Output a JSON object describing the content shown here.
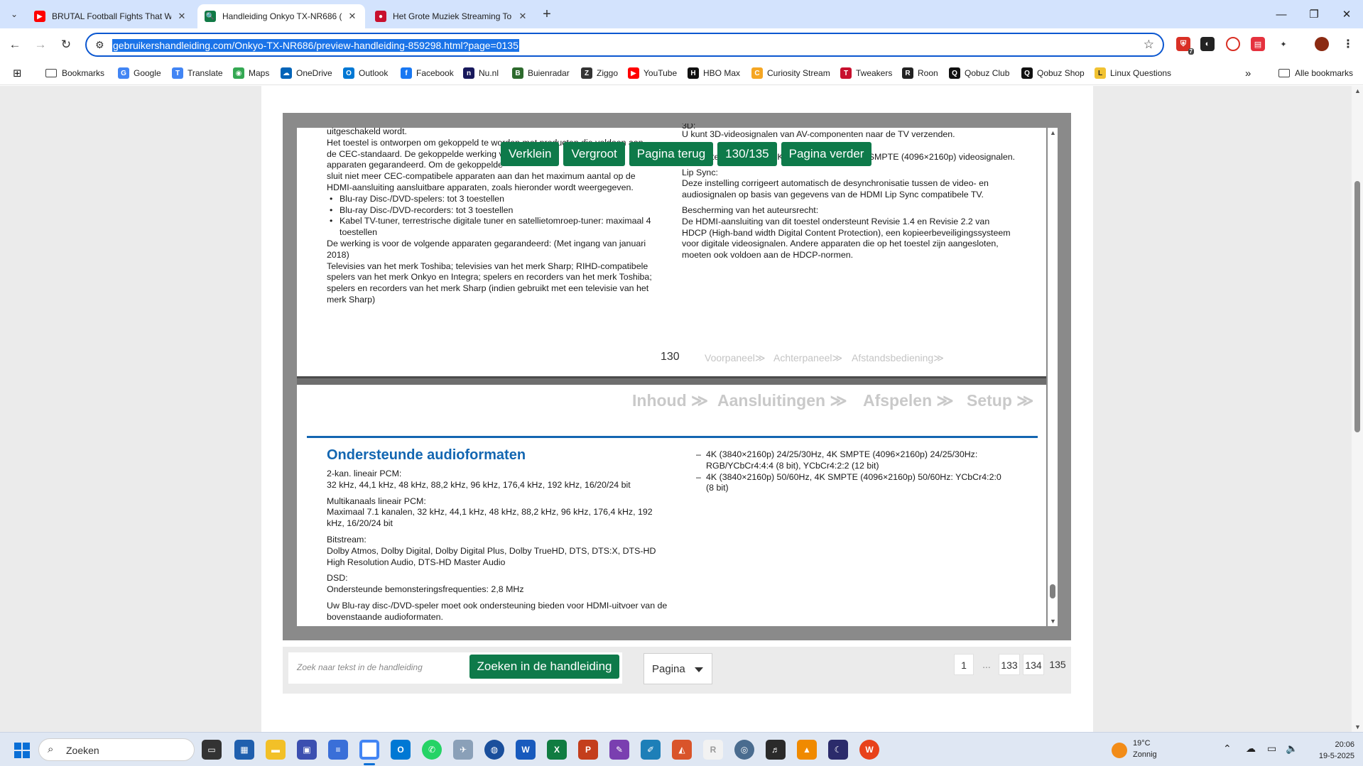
{
  "browser": {
    "tabs": [
      {
        "title": "BRUTAL Football Fights That W",
        "favicon": "youtube-icon",
        "color": "#ff0000"
      },
      {
        "title": "Handleiding Onkyo TX-NR686 (",
        "favicon": "manual-icon",
        "color": "#117a46"
      },
      {
        "title": "Het Grote Muziek Streaming To",
        "favicon": "streaming-icon",
        "color": "#c8102e"
      }
    ],
    "url": "gebruikershandleiding.com/Onkyo-TX-NR686/preview-handleiding-859298.html?page=0135",
    "extension_badge": "7",
    "bookmarks": [
      {
        "label": "Bookmarks",
        "icon": "folder-icon"
      },
      {
        "label": "Google",
        "icon": "google-icon",
        "color": "#4285f4",
        "glyph": "G"
      },
      {
        "label": "Translate",
        "icon": "translate-icon",
        "color": "#4285f4",
        "glyph": "T"
      },
      {
        "label": "Maps",
        "icon": "maps-icon",
        "color": "#34a853",
        "glyph": "◉"
      },
      {
        "label": "OneDrive",
        "icon": "onedrive-icon",
        "color": "#0364b8",
        "glyph": "☁"
      },
      {
        "label": "Outlook",
        "icon": "outlook-icon",
        "color": "#0078d4",
        "glyph": "O"
      },
      {
        "label": "Facebook",
        "icon": "facebook-icon",
        "color": "#1877f2",
        "glyph": "f"
      },
      {
        "label": "Nu.nl",
        "icon": "nunl-icon",
        "color": "#18195c",
        "glyph": "n"
      },
      {
        "label": "Buienradar",
        "icon": "buienradar-icon",
        "color": "#2d6a2d",
        "glyph": "B"
      },
      {
        "label": "Ziggo",
        "icon": "ziggo-icon",
        "color": "#333333",
        "glyph": "Z"
      },
      {
        "label": "YouTube",
        "icon": "youtube-icon",
        "color": "#ff0000",
        "glyph": "▶"
      },
      {
        "label": "HBO Max",
        "icon": "hbomax-icon",
        "color": "#111111",
        "glyph": "H"
      },
      {
        "label": "Curiosity Stream",
        "icon": "curiosity-icon",
        "color": "#f5a623",
        "glyph": "C"
      },
      {
        "label": "Tweakers",
        "icon": "tweakers-icon",
        "color": "#c8102e",
        "glyph": "T"
      },
      {
        "label": "Roon",
        "icon": "roon-icon",
        "color": "#222222",
        "glyph": "R"
      },
      {
        "label": "Qobuz Club",
        "icon": "qobuz-icon",
        "color": "#111111",
        "glyph": "Q"
      },
      {
        "label": "Qobuz Shop",
        "icon": "qobuz-shop-icon",
        "color": "#111111",
        "glyph": "Q"
      },
      {
        "label": "Linux Questions",
        "icon": "linux-icon",
        "color": "#f1c232",
        "glyph": "L"
      }
    ],
    "all_bookmarks": "Alle bookmarks"
  },
  "viewer": {
    "buttons": {
      "zoom_out": "Verklein",
      "zoom_in": "Vergroot",
      "prev": "Pagina terug",
      "counter": "130/135",
      "next": "Pagina verder"
    },
    "page130": {
      "left": [
        "uitgeschakeld wordt.",
        "Het toestel is ontworpen om gekoppeld te worden met producten die voldoen aan",
        "de CEC-standaard. De gekoppelde werking van",
        "apparaten gegarandeerd. Om de gekoppelde",
        "sluit niet meer CEC-compatibele apparaten aan dan het maximum aantal op de",
        "HDMI-aansluiting aansluitbare apparaten, zoals hieronder wordt weergegeven."
      ],
      "bullets": [
        "Blu-ray Disc-/DVD-spelers: tot 3 toestellen",
        "Blu-ray Disc-/DVD-recorders: tot 3 toestellen",
        "Kabel TV-tuner, terrestrische digitale tuner en satellietomroep-tuner: maximaal 4 toestellen"
      ],
      "left_after": [
        "De werking is voor de volgende apparaten gegarandeerd: (Met ingang van januari 2018)",
        "Televisies van het merk Toshiba; televisies van het merk Sharp; RIHD-compatibele spelers van het merk Onkyo en Integra; spelers en recorders van het merk Toshiba; spelers en recorders van het merk Sharp (indien gebruikt met een televisie van het merk Sharp)"
      ],
      "right_top": "3D:",
      "right_3d": "U kunt 3D-videosignalen van AV-componenten naar de TV verzenden.",
      "right_4k": "Dit toestel ondersteunt 4K (3840×2160p) en 4K SMPTE (4096×2160p) videosignalen.",
      "lipsync_head": "Lip Sync:",
      "lipsync_text": "Deze instelling corrigeert automatisch de desynchronisatie tussen de video- en audiosignalen op basis van gegevens van de HDMI Lip Sync compatibele TV.",
      "copy_head": "Bescherming van het auteursrecht:",
      "copy_text": "De HDMI-aansluiting van dit toestel ondersteunt Revisie 1.4 en Revisie 2.2 van HDCP (High-band width Digital Content Protection), een kopieerbeveiligingssysteem voor digitale videosignalen. Andere apparaten die op het toestel zijn aangesloten, moeten ook voldoen aan de HDCP-normen.",
      "page_number": "130",
      "mini_links": [
        "Voorpaneel≫",
        "Achterpaneel≫",
        "Afstandsbediening≫"
      ]
    },
    "page131": {
      "nav": [
        "Inhoud ≫",
        "Aansluitingen ≫",
        "Afspelen ≫",
        "Setup ≫"
      ],
      "title": "Ondersteunde audioformaten",
      "blocks": [
        {
          "head": "2-kan. lineair PCM:",
          "text": "32 kHz, 44,1 kHz, 48 kHz, 88,2 kHz, 96 kHz, 176,4 kHz, 192 kHz, 16/20/24 bit"
        },
        {
          "head": "Multikanaals lineair PCM:",
          "text": "Maximaal 7.1 kanalen, 32 kHz, 44,1 kHz, 48 kHz, 88,2 kHz, 96 kHz, 176,4 kHz, 192 kHz, 16/20/24 bit"
        },
        {
          "head": "Bitstream:",
          "text": "Dolby Atmos, Dolby Digital, Dolby Digital Plus, Dolby TrueHD, DTS, DTS:X, DTS-HD High Resolution Audio, DTS-HD Master Audio"
        },
        {
          "head": "DSD:",
          "text": "Ondersteunde bemonsteringsfrequenties: 2,8 MHz"
        },
        {
          "head": "",
          "text": "Uw Blu-ray disc-/DVD-speler moet ook ondersteuning bieden voor HDMI-uitvoer van de bovenstaande audioformaten."
        }
      ],
      "right_items": [
        "4K (3840×2160p) 24/25/30Hz, 4K SMPTE (4096×2160p) 24/25/30Hz: RGB/YCbCr4:4:4 (8 bit), YCbCr4:2:2 (12 bit)",
        "4K (3840×2160p) 50/60Hz, 4K SMPTE (4096×2160p) 50/60Hz: YCbCr4:2:0 (8 bit)"
      ]
    }
  },
  "search": {
    "placeholder": "Zoek naar tekst in de handleiding",
    "button": "Zoeken in de handleiding",
    "select": "Pagina"
  },
  "pagination": [
    "1",
    "...",
    "133",
    "134",
    "135"
  ],
  "taskbar": {
    "search": "Zoeken",
    "weather_temp": "19°C",
    "weather_state": "Zonnig",
    "time": "20:06",
    "date": "19-5-2025"
  }
}
